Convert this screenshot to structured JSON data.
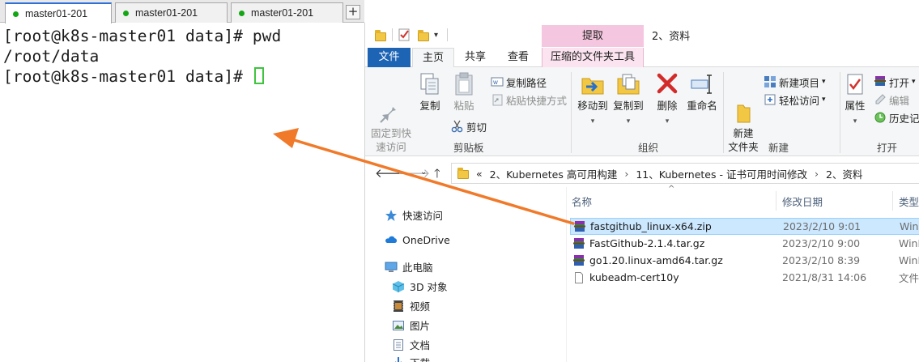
{
  "terminal": {
    "tabs": [
      {
        "label": "master01-201"
      },
      {
        "label": "master01-201"
      },
      {
        "label": "master01-201"
      }
    ],
    "add_tab_label": "+",
    "lines": [
      "[root@k8s-master01 data]# pwd",
      "/root/data",
      "[root@k8s-master01 data]# "
    ]
  },
  "explorer": {
    "title": "2、资料",
    "context_tab_header": "提取",
    "ribbon_tabs": {
      "file": "文件",
      "home": "主页",
      "share": "共享",
      "view": "查看",
      "tool": "压缩的文件夹工具"
    },
    "ribbon": {
      "pin": "固定到快\n速访问",
      "copy": "复制",
      "paste": "粘贴",
      "copy_path": "复制路径",
      "paste_shortcut": "粘贴快捷方式",
      "cut": "剪切",
      "clipboard_group": "剪贴板",
      "move_to": "移动到",
      "copy_to": "复制到",
      "delete": "删除",
      "rename": "重命名",
      "organize_group": "组织",
      "new_folder": "新建\n文件夹",
      "new_item": "新建项目",
      "easy_access": "轻松访问",
      "new_group": "新建",
      "properties": "属性",
      "open": "打开",
      "edit": "编辑",
      "history": "历史记",
      "open_group": "打开"
    },
    "address": {
      "prefix": "«",
      "parts": [
        "2、Kubernetes 高可用构建",
        "11、Kubernetes - 证书可用时间修改",
        "2、资料"
      ]
    },
    "nav": [
      {
        "label": "快速访问",
        "icon": "star-icon"
      },
      {
        "label": "OneDrive",
        "icon": "cloud-icon"
      },
      {
        "label": "此电脑",
        "icon": "computer-icon"
      },
      {
        "label": "3D 对象",
        "icon": "cube-icon"
      },
      {
        "label": "视频",
        "icon": "video-icon"
      },
      {
        "label": "图片",
        "icon": "picture-icon"
      },
      {
        "label": "文档",
        "icon": "document-icon"
      },
      {
        "label": "下载",
        "icon": "download-icon"
      }
    ],
    "columns": {
      "name": "名称",
      "modified": "修改日期",
      "type": "类型"
    },
    "files": [
      {
        "name": "fastgithub_linux-x64.zip",
        "date": "2023/2/10 9:01",
        "type": "WinR",
        "icon": "rar-icon",
        "selected": true
      },
      {
        "name": "FastGithub-2.1.4.tar.gz",
        "date": "2023/2/10 9:00",
        "type": "WinR",
        "icon": "rar-icon",
        "selected": false
      },
      {
        "name": "go1.20.linux-amd64.tar.gz",
        "date": "2023/2/10 8:39",
        "type": "WinR",
        "icon": "rar-icon",
        "selected": false
      },
      {
        "name": "kubeadm-cert10y",
        "date": "2021/8/31 14:06",
        "type": "文件",
        "icon": "blank-file-icon",
        "selected": false
      }
    ]
  },
  "colors": {
    "accent": "#1e64b4",
    "annotation_arrow": "#f07a2a",
    "terminal_cursor": "#3ec43e",
    "selection": "#cce8ff"
  }
}
